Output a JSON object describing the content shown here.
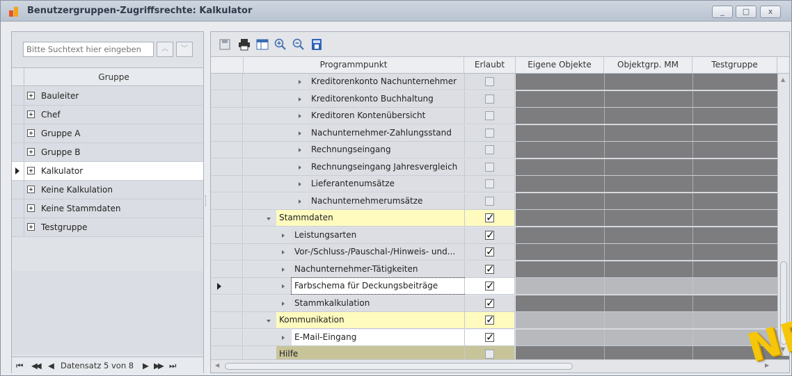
{
  "window": {
    "title": "Benutzergruppen-Zugriffsrechte: Kalkulator",
    "controls": {
      "minimize": "_",
      "maximize": "□",
      "close": "x"
    }
  },
  "left": {
    "search_placeholder": "Bitte Suchtext hier eingeben",
    "column_header": "Gruppe",
    "groups": [
      "Bauleiter",
      "Chef",
      "Gruppe A",
      "Gruppe B",
      "Kalkulator",
      "Keine Kalkulation",
      "Keine Stammdaten",
      "Testgruppe"
    ],
    "selected_group": "Kalkulator",
    "pager": {
      "first": "⏮",
      "prev_page": "◀◀",
      "prev": "◀",
      "record_text": "Datensatz 5 von 8",
      "next": "▶",
      "next_page": "▶▶",
      "last": "⏭"
    }
  },
  "grid": {
    "columns": [
      "Programmpunkt",
      "Erlaubt",
      "Eigene Objekte",
      "Objektgrp. MM",
      "Testgruppe"
    ],
    "rows": [
      {
        "label": "Kreditorenkonto Nachunternehmer",
        "checked": false
      },
      {
        "label": "Kreditorenkonto Buchhaltung",
        "checked": false
      },
      {
        "label": "Kreditoren Kontenübersicht",
        "checked": false
      },
      {
        "label": "Nachunternehmer-Zahlungsstand",
        "checked": false
      },
      {
        "label": "Rechnungseingang",
        "checked": false
      },
      {
        "label": "Rechnungseingang Jahresvergleich",
        "checked": false
      },
      {
        "label": "Lieferantenumsätze",
        "checked": false
      },
      {
        "label": "Nachunternehmerumsätze",
        "checked": false
      },
      {
        "label": "Stammdaten",
        "checked": true
      },
      {
        "label": "Leistungsarten",
        "checked": true
      },
      {
        "label": "Vor-/Schluss-/Pauschal-/Hinweis- und...",
        "checked": true
      },
      {
        "label": "Nachunternehmer-Tätigkeiten",
        "checked": true
      },
      {
        "label": "Farbschema für Deckungsbeiträge",
        "checked": true
      },
      {
        "label": "Stammkalkulation",
        "checked": true
      },
      {
        "label": "Kommunikation",
        "checked": true
      },
      {
        "label": "E-Mail-Eingang",
        "checked": true
      },
      {
        "label": "Hilfe",
        "checked": false
      }
    ]
  },
  "badge": "NEU!",
  "colors": {
    "accent_yellow": "#fffbbf",
    "dark_gray": "#7d7d7f",
    "help_row": "#c8c49a"
  }
}
